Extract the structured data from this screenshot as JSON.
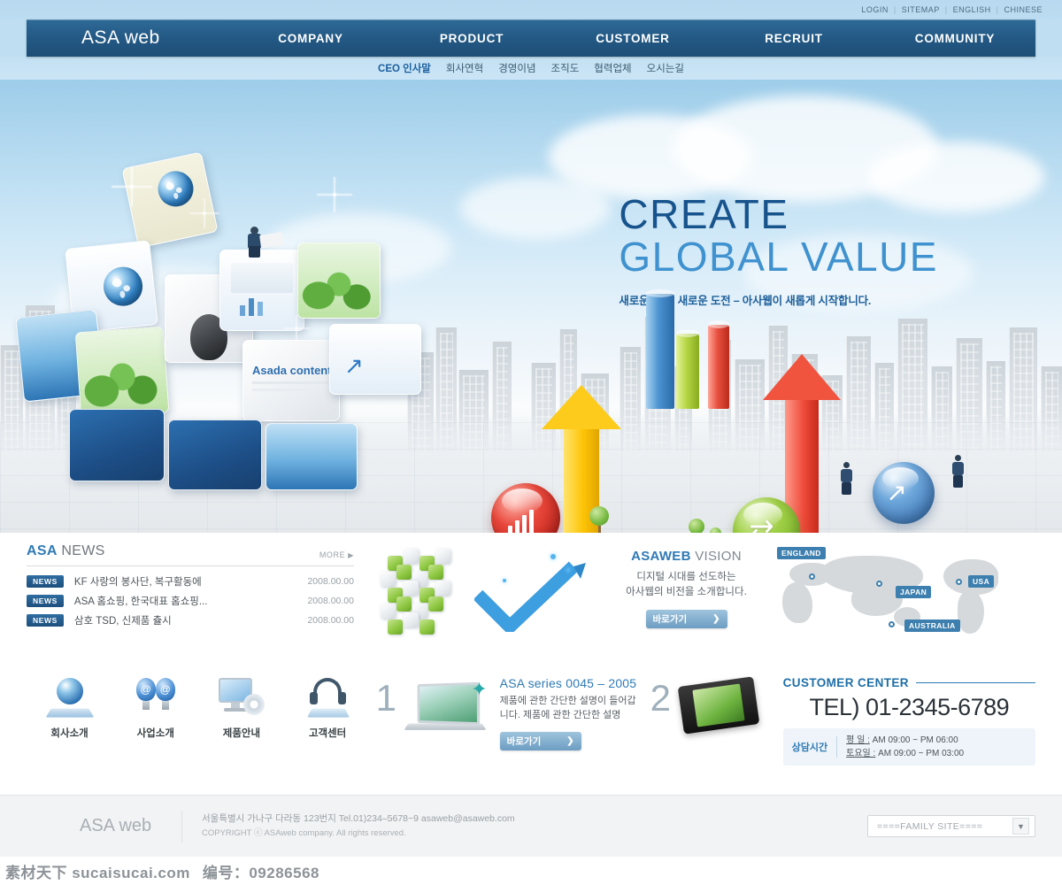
{
  "topbar": {
    "links": [
      "LOGIN",
      "SITEMAP",
      "ENGLISH",
      "CHINESE"
    ],
    "separator": "|"
  },
  "header": {
    "logo": "ASA web",
    "nav": [
      "COMPANY",
      "PRODUCT",
      "CUSTOMER",
      "RECRUIT",
      "COMMUNITY"
    ],
    "subnav": [
      "CEO 인사말",
      "회사연혁",
      "경영이념",
      "조직도",
      "협력업체",
      "오시는길"
    ],
    "subnav_active_index": 0
  },
  "hero": {
    "headline_line1": "CREATE",
    "headline_line2": "GLOBAL VALUE",
    "tagline": "새로운 생각, 새로운 도전 – 아사웹이 새롭게 시작합니다.",
    "cube_label": "Asada contents",
    "colors": {
      "headline_dark": "#17538c",
      "headline_light": "#3f92cf",
      "tagline": "#1d5f9b"
    }
  },
  "news": {
    "title_brand": "ASA",
    "title_rest": " NEWS",
    "more_label": "MORE",
    "more_arrow": "▶",
    "badge": "NEWS",
    "items": [
      {
        "text": "KF 사랑의 봉사단, 복구활동에",
        "date": "2008.00.00"
      },
      {
        "text": "ASA 홈쇼핑, 한국대표 홈쇼핑...",
        "date": "2008.00.00"
      },
      {
        "text": "삼호 TSD, 신제품 츌시",
        "date": "2008.00.00"
      }
    ]
  },
  "vision": {
    "title_brand": "ASAWEB",
    "title_rest": " VISION",
    "desc_line1": "디지털 시대를 선도하는",
    "desc_line2": "아사웹의 비전을 소개합니다.",
    "button_label": "바로가기",
    "button_chevron": "❯"
  },
  "worldmap": {
    "labels": [
      "ENGLAND",
      "JAPAN",
      "USA",
      "AUSTRALIA"
    ],
    "marker_color": "#3d7fae"
  },
  "quicklinks": [
    {
      "label": "회사소개",
      "icon": "globe-book-icon"
    },
    {
      "label": "사업소개",
      "icon": "lightbulb-at-icon"
    },
    {
      "label": "제품안내",
      "icon": "monitor-cd-icon"
    },
    {
      "label": "고객센터",
      "icon": "headset-book-icon"
    }
  ],
  "promo": {
    "items": [
      {
        "number": "1",
        "title": "ASA series 0045 – 2005",
        "desc_line1": "제품에 관한 간단한 설명이 들어갑",
        "desc_line2": "니다. 제품에 관한 간단한 설명",
        "button_label": "바로가기",
        "button_chevron": "❯",
        "image": "laptop-butterfly-image"
      },
      {
        "number": "2",
        "title": "",
        "desc_line1": "",
        "desc_line2": "",
        "button_label": "",
        "button_chevron": "",
        "image": "pmp-device-image"
      }
    ]
  },
  "customer_center": {
    "title": "CUSTOMER CENTER",
    "tel": "TEL) 01-2345-6789",
    "hours_label": "상담시간",
    "hours": [
      {
        "day": "평   일 :",
        "time": "AM 09:00 ~ PM 06:00"
      },
      {
        "day": "토요일 :",
        "time": "AM 09:00 ~ PM 03:00"
      }
    ]
  },
  "footer": {
    "logo": "ASA web",
    "address": "서울특별시 가나구 다라동 123번지 Tel.01)234–5678~9 asaweb@asaweb.com",
    "copyright": "COPYRIGHT ⓒ ASAweb company. All rights reserved.",
    "family_site": "====FAMILY SITE====",
    "family_site_chevron": "▼"
  },
  "watermark": {
    "site": "素材天下 sucaisucai.com",
    "number": "编号：09286568"
  }
}
